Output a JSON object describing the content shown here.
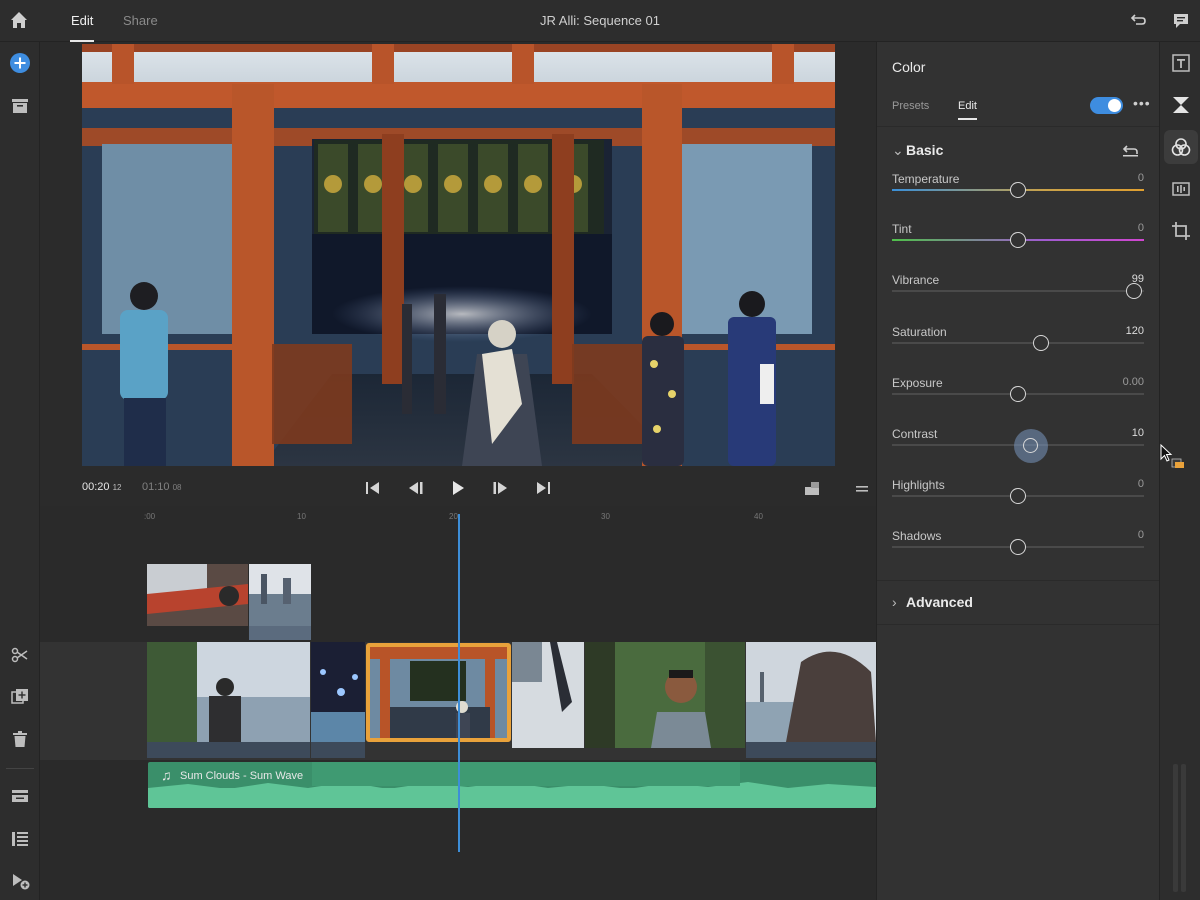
{
  "topbar": {
    "tabs": [
      {
        "label": "Edit",
        "active": true
      },
      {
        "label": "Share",
        "active": false
      }
    ],
    "sequence_title": "JR Alli: Sequence 01"
  },
  "transport": {
    "current_time": "00:20",
    "current_frames": "12",
    "total_time": "01:10",
    "total_frames": "08"
  },
  "timeline": {
    "ruler_ticks": [
      ":00",
      "10",
      "20",
      "30",
      "40"
    ],
    "audio_clip_label": "Sum Clouds - Sum Wave"
  },
  "color_panel": {
    "title": "Color",
    "tabs": [
      {
        "label": "Presets",
        "active": false
      },
      {
        "label": "Edit",
        "active": true
      }
    ],
    "enabled": true,
    "basic_section": "Basic",
    "advanced_section": "Advanced",
    "sliders": [
      {
        "label": "Temperature",
        "value": "0",
        "position": 0.5
      },
      {
        "label": "Tint",
        "value": "0",
        "position": 0.5
      },
      {
        "label": "Vibrance",
        "value": "99",
        "position": 0.96
      },
      {
        "label": "Saturation",
        "value": "120",
        "position": 0.59
      },
      {
        "label": "Exposure",
        "value": "0.00",
        "position": 0.5
      },
      {
        "label": "Contrast",
        "value": "10",
        "position": 0.55
      },
      {
        "label": "Highlights",
        "value": "0",
        "position": 0.5
      },
      {
        "label": "Shadows",
        "value": "0",
        "position": 0.5
      }
    ]
  },
  "colors": {
    "accent": "#3e8de0",
    "selected_clip_border": "#e9a23b",
    "audio_clip": "#3a8f6a",
    "playhead": "#3d8ed8"
  }
}
